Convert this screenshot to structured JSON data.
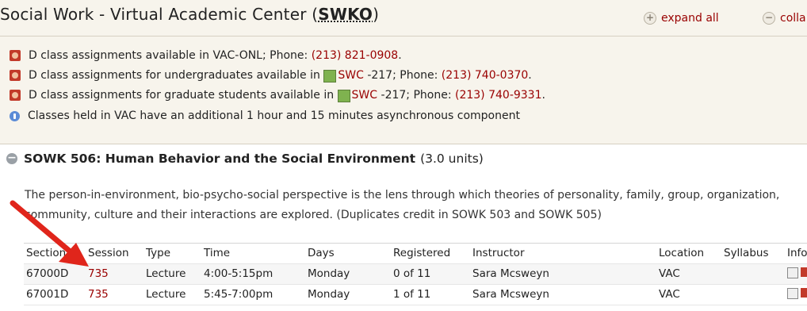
{
  "header": {
    "dept_title": "Social Work - Virtual Academic Center",
    "dept_code": "SWKO",
    "expand_all": "expand all",
    "collapse_all": "colla"
  },
  "notes": [
    {
      "pre": "D class assignments available in VAC-ONL; Phone:",
      "phone": "(213) 821-0908",
      "post": "."
    },
    {
      "pre": "D class assignments for undergraduates available in",
      "building": "SWC",
      "room": "-217; Phone:",
      "phone": "(213) 740-0370",
      "post": "."
    },
    {
      "pre": "D class assignments for graduate students available in",
      "building": "SWC",
      "room": "-217; Phone:",
      "phone": "(213) 740-9331",
      "post": "."
    },
    {
      "text": "Classes held in VAC have an additional 1 hour and 15 minutes asynchronous component"
    }
  ],
  "course": {
    "title": "SOWK 506: Human Behavior and the Social Environment",
    "units": "(3.0 units)",
    "desc_line1": "The person-in-environment, bio-psycho-social perspective is the lens through which theories of personality, family, group, organization,",
    "desc_line2": "community, culture and their interactions are explored. (Duplicates credit in SOWK 503 and SOWK 505)"
  },
  "table": {
    "columns": [
      "Section",
      "Session",
      "Type",
      "Time",
      "Days",
      "Registered",
      "Instructor",
      "Location",
      "Syllabus",
      "Info"
    ],
    "rows": [
      {
        "section": "67000D",
        "session": "735",
        "type": "Lecture",
        "time": "4:00-5:15pm",
        "days": "Monday",
        "registered": "0 of 11",
        "instructor": "Sara Mcsweyn",
        "location": "VAC",
        "syllabus": ""
      },
      {
        "section": "67001D",
        "session": "735",
        "type": "Lecture",
        "time": "5:45-7:00pm",
        "days": "Monday",
        "registered": "1 of 11",
        "instructor": "Sara Mcsweyn",
        "location": "VAC",
        "syllabus": ""
      }
    ]
  },
  "colors": {
    "link": "#990000",
    "header_bg": "#f7f4ec",
    "arrow": "#e0251b"
  },
  "icons": {
    "phone": "phone-book-icon",
    "info": "info-bubble-icon",
    "map": "map-icon",
    "calendar": "calendar-icon"
  }
}
